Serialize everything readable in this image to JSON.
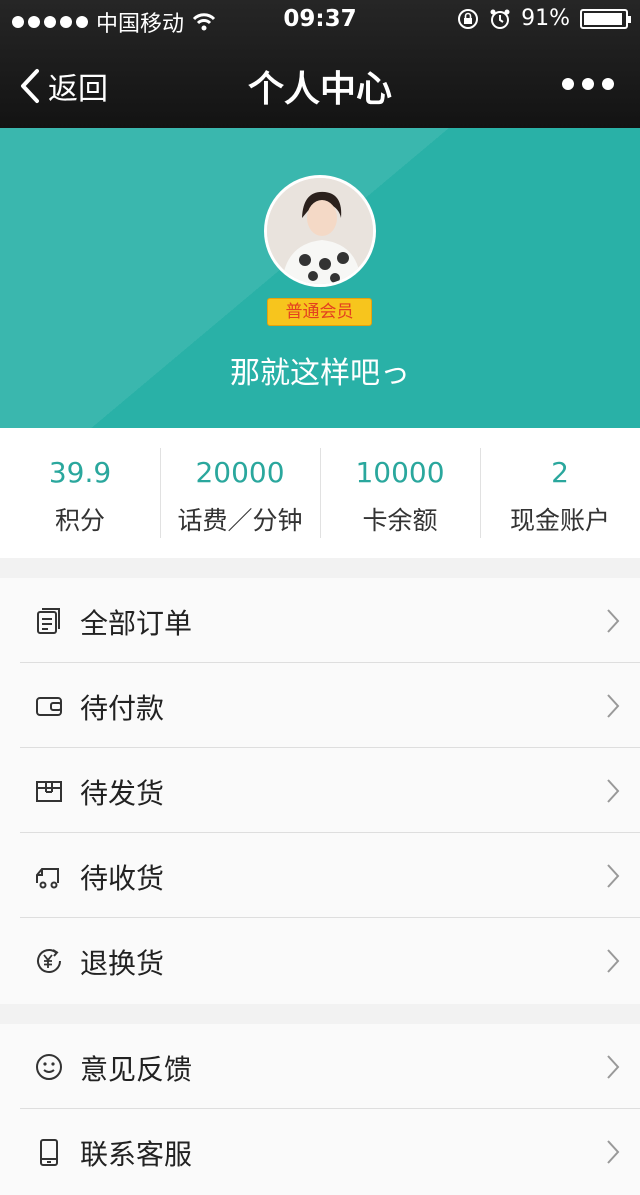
{
  "status": {
    "carrier": "中国移动",
    "time": "09:37",
    "battery": "91%"
  },
  "nav": {
    "back_label": "返回",
    "title": "个人中心"
  },
  "profile": {
    "badge": "普通会员",
    "username": "那就这样吧っ"
  },
  "stats": [
    {
      "value": "39.9",
      "label": "积分"
    },
    {
      "value": "20000",
      "label": "话费／分钟"
    },
    {
      "value": "10000",
      "label": "卡余额"
    },
    {
      "value": "2",
      "label": "现金账户"
    }
  ],
  "menu": [
    {
      "label": "全部订单",
      "icon": "orders-icon"
    },
    {
      "label": "待付款",
      "icon": "wallet-icon"
    },
    {
      "label": "待发货",
      "icon": "box-icon"
    },
    {
      "label": "待收货",
      "icon": "truck-icon"
    },
    {
      "label": "退换货",
      "icon": "refund-icon"
    }
  ],
  "menu2": [
    {
      "label": "意见反馈",
      "icon": "smile-icon"
    },
    {
      "label": "联系客服",
      "icon": "phone-icon"
    }
  ],
  "colors": {
    "accent": "#29b1a7",
    "stat_value": "#2aa79d",
    "badge_bg": "#f7c51d",
    "badge_text": "#e3411f"
  }
}
